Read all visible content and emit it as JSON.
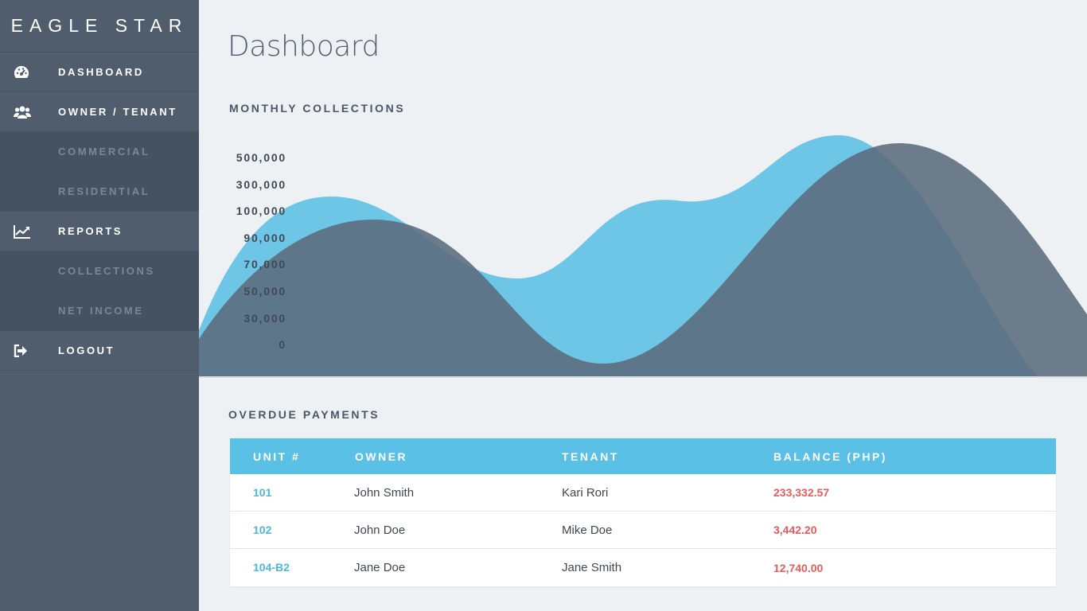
{
  "brand": "EAGLE STAR",
  "nav": {
    "dashboard": "DASHBOARD",
    "owner_tenant": "OWNER / TENANT",
    "commercial": "COMMERCIAL",
    "residential": "RESIDENTIAL",
    "reports": "REPORTS",
    "collections": "COLLECTIONS",
    "net_income": "NET INCOME",
    "logout": "LOGOUT"
  },
  "icons": {
    "dashboard": "dashboard-gauge-icon",
    "owner_tenant": "users-icon",
    "reports": "line-chart-icon",
    "logout": "sign-out-icon"
  },
  "page_title": "Dashboard",
  "collections_title": "MONTHLY COLLECTIONS",
  "y_axis_labels": [
    "500,000",
    "300,000",
    "100,000",
    "90,000",
    "70,000",
    "50,000",
    "30,000",
    "0"
  ],
  "chart_colors": {
    "series_a": "#6ec6e6",
    "series_b": "#5b6b7c"
  },
  "overdue_title": "OVERDUE PAYMENTS",
  "table": {
    "headers": {
      "unit": "UNIT #",
      "owner": "OWNER",
      "tenant": "TENANT",
      "balance": "BALANCE (PHP)"
    },
    "rows": [
      {
        "unit": "101",
        "owner": "John Smith",
        "tenant": "Kari Rori",
        "balance": "233,332.57"
      },
      {
        "unit": "102",
        "owner": "John Doe",
        "tenant": "Mike Doe",
        "balance": "3,442.20"
      },
      {
        "unit": "104-B2",
        "owner": "Jane Doe",
        "tenant": "Jane Smith",
        "balance": "12,740.00"
      }
    ]
  },
  "colors": {
    "sidebar": "#4f5d6d",
    "accent": "#5bc0e6",
    "overdue": "#e85b5b",
    "link": "#4fb6dd"
  }
}
